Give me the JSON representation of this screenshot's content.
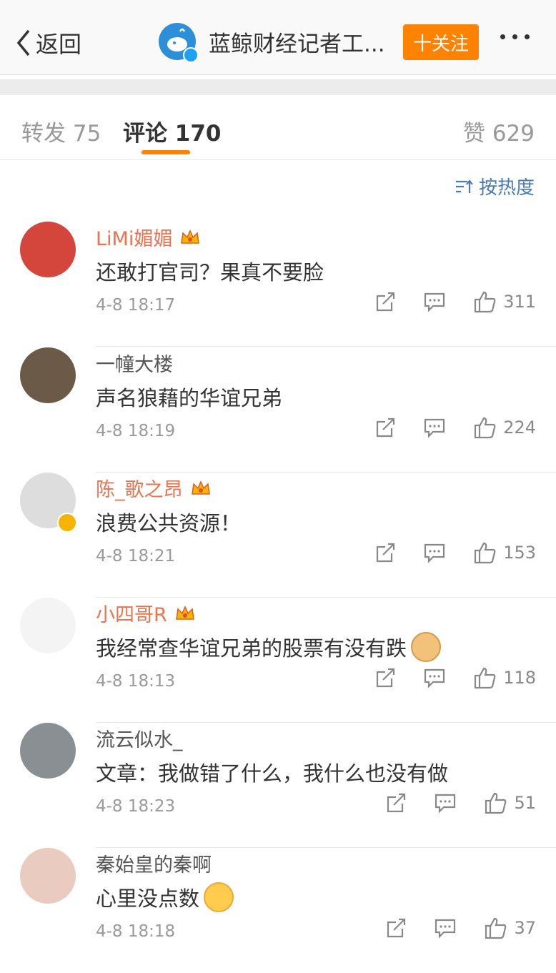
{
  "nav": {
    "back_label": "返回",
    "account_name": "蓝鲸财经记者工...",
    "follow_label": "十关注"
  },
  "tabs": [
    {
      "label": "转发 75"
    },
    {
      "label": "评论 170"
    },
    {
      "label": "赞 629"
    }
  ],
  "sort_label": "按热度",
  "comments": [
    {
      "name": "LiMi媚媚",
      "vip": true,
      "text": "还敢打官司？果真不要脸",
      "time": "4-8 18:17",
      "likes": "311",
      "avatar": "#d4453b"
    },
    {
      "name": "一幢大楼",
      "vip": false,
      "text": "声名狼藉的华谊兄弟",
      "time": "4-8 18:19",
      "likes": "224",
      "avatar": "#6b5a47"
    },
    {
      "name": "陈_歌之昂",
      "vip": true,
      "text": "浪费公共资源！",
      "time": "4-8 18:21",
      "likes": "153",
      "avatar": "#ddd"
    },
    {
      "name": "小四哥R",
      "vip": true,
      "text": "我经常查华谊兄弟的股票有没有跌",
      "time": "4-8 18:13",
      "likes": "118",
      "avatar": "#f4f4f4"
    },
    {
      "name": "流云似水_",
      "vip": false,
      "text": "文章：我做错了什么，我什么也没有做",
      "time": "4-8 18:23",
      "likes": "51",
      "avatar": "#8a8f94"
    },
    {
      "name": "秦始皇的秦啊",
      "vip": false,
      "text": "心里没点数",
      "time": "4-8 18:18",
      "likes": "37",
      "avatar": "#e9cbbf"
    }
  ],
  "colors": {
    "accent": "#ff8200",
    "vip_name": "#eb7350",
    "link_blue": "#4a7ab8"
  }
}
